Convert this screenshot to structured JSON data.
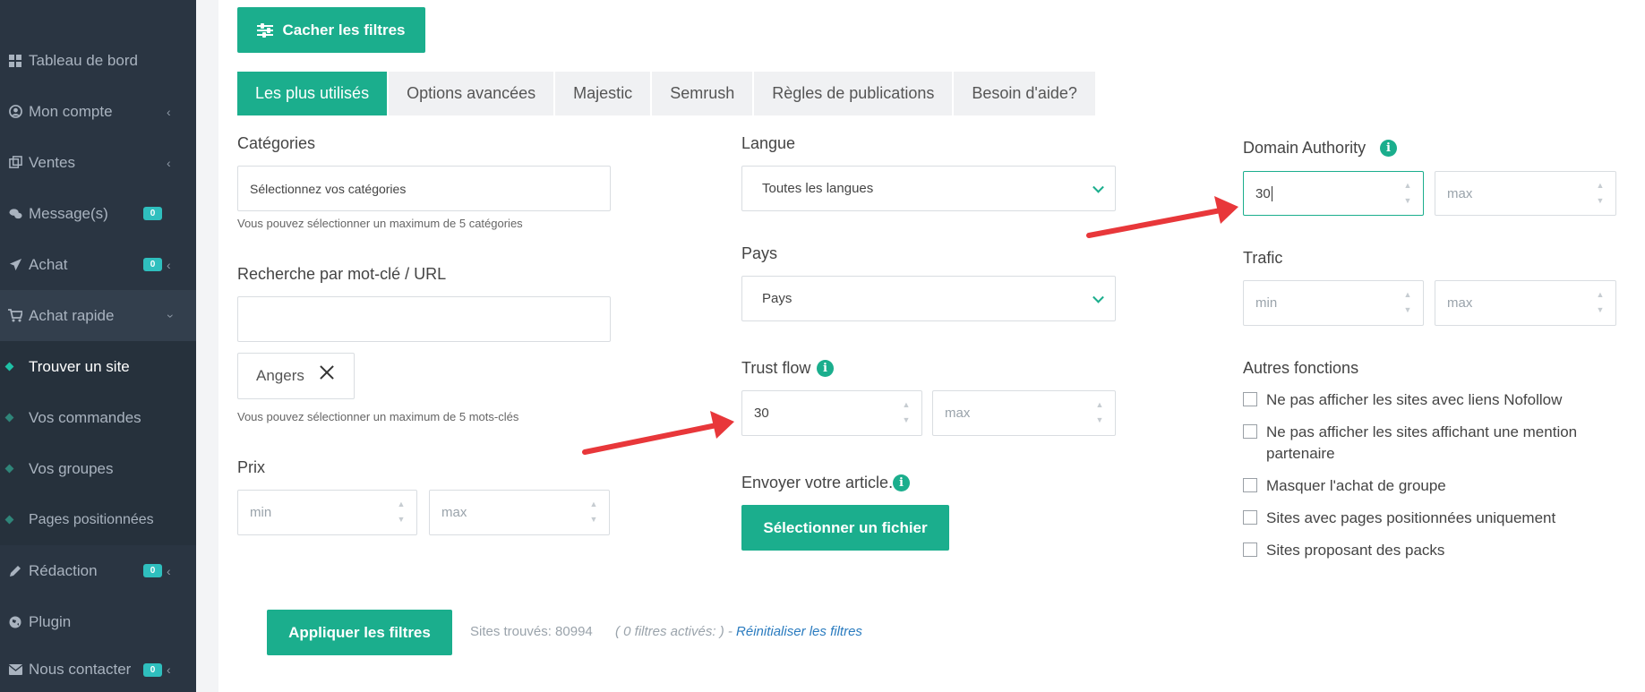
{
  "sidebar": {
    "items": [
      {
        "label": "Tableau de bord",
        "icon": "dashboard-icon"
      },
      {
        "label": "Mon compte",
        "icon": "user-icon"
      },
      {
        "label": "Ventes",
        "icon": "sales-icon"
      },
      {
        "label": "Message(s)",
        "icon": "chat-icon",
        "badge": "0"
      },
      {
        "label": "Achat",
        "icon": "send-icon",
        "badge": "0"
      },
      {
        "label": "Achat rapide",
        "icon": "cart-icon"
      }
    ],
    "sub_items": [
      {
        "label": "Trouver un site"
      },
      {
        "label": "Vos commandes"
      },
      {
        "label": "Vos groupes"
      },
      {
        "label": "Pages positionnées"
      }
    ],
    "bottom_items": [
      {
        "label": "Rédaction",
        "icon": "pencil-icon",
        "badge": "0"
      },
      {
        "label": "Plugin",
        "icon": "globe-icon"
      },
      {
        "label": "Nous contacter",
        "icon": "mail-icon",
        "badge": "0"
      }
    ]
  },
  "toolbar": {
    "hide_filters_label": "Cacher les filtres"
  },
  "tabs": [
    {
      "label": "Les plus utilisés"
    },
    {
      "label": "Options avancées"
    },
    {
      "label": "Majestic"
    },
    {
      "label": "Semrush"
    },
    {
      "label": "Règles de publications"
    },
    {
      "label": "Besoin d'aide?"
    }
  ],
  "filters": {
    "categories": {
      "label": "Catégories",
      "value": "Sélectionnez vos catégories",
      "help": "Vous pouvez sélectionner un maximum de 5 catégories"
    },
    "keyword": {
      "label": "Recherche par mot-clé / URL",
      "value": "",
      "tag": "Angers",
      "help": "Vous pouvez sélectionner un maximum de 5 mots-clés"
    },
    "price": {
      "label": "Prix",
      "min_placeholder": "min",
      "max_placeholder": "max"
    },
    "language": {
      "label": "Langue",
      "value": "Toutes les langues"
    },
    "country": {
      "label": "Pays",
      "value": "Pays"
    },
    "trust_flow": {
      "label": "Trust flow",
      "min_value": "30",
      "max_placeholder": "max"
    },
    "upload": {
      "label": "Envoyer votre article.",
      "button_label": "Sélectionner un fichier"
    },
    "domain_authority": {
      "label": "Domain Authority",
      "min_value": "30",
      "max_placeholder": "max"
    },
    "traffic": {
      "label": "Trafic",
      "min_placeholder": "min",
      "max_placeholder": "max"
    },
    "other": {
      "label": "Autres fonctions",
      "options": [
        {
          "label": "Ne pas afficher les sites avec liens Nofollow",
          "checked": false
        },
        {
          "label": "Ne pas afficher les sites affichant une mention partenaire",
          "checked": false
        },
        {
          "label": "Masquer l'achat de groupe",
          "checked": false
        },
        {
          "label": "Sites avec pages positionnées uniquement",
          "checked": false
        },
        {
          "label": "Sites proposant des packs",
          "checked": false
        }
      ]
    }
  },
  "footer": {
    "apply_label": "Appliquer les filtres",
    "sites_found": "Sites trouvés: 80994",
    "active_filters": "( 0 filtres activés: ) -",
    "reset_label": "Réinitialiser les filtres"
  },
  "colors": {
    "accent": "#1bae8d",
    "sidebar_bg": "#2a3542",
    "badge": "#2fbfbe",
    "annotation_arrow": "#e8373a"
  }
}
